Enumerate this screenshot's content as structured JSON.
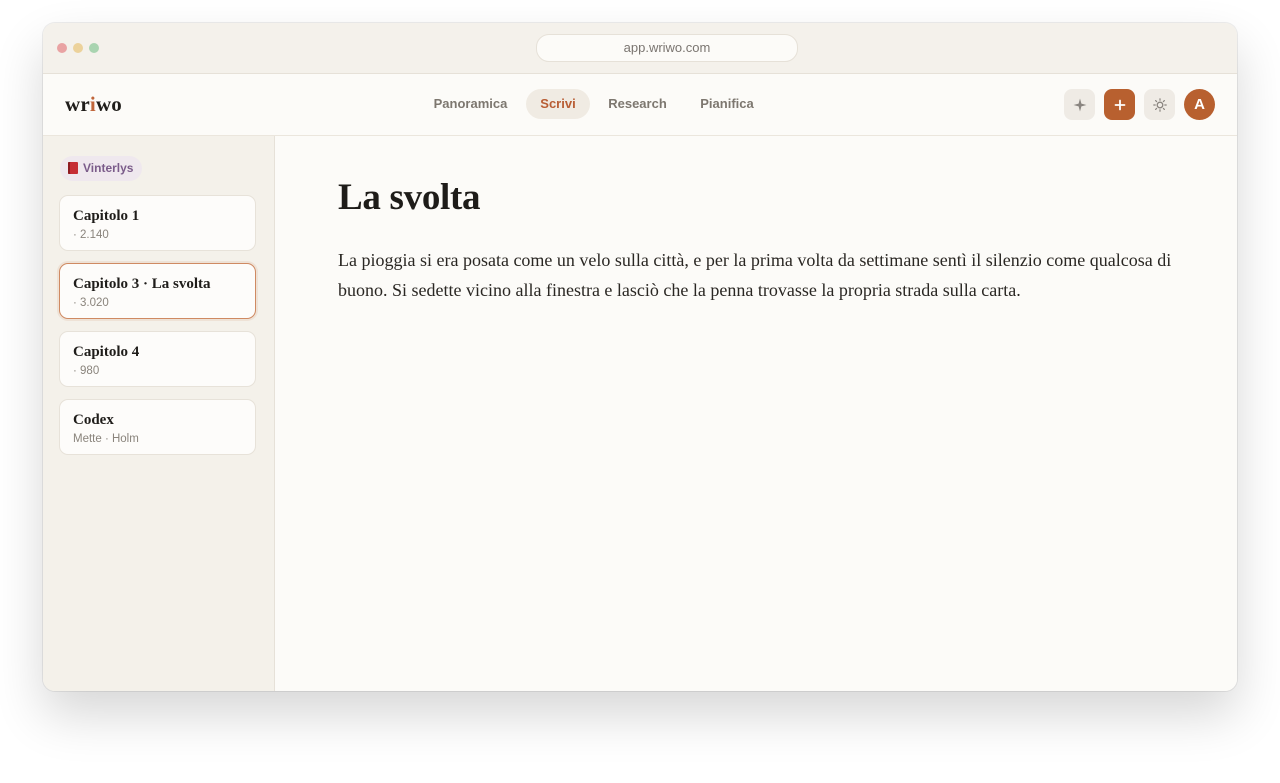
{
  "browser": {
    "url": "app.wriwo.com"
  },
  "app": {
    "logo_pre": "wr",
    "logo_accent": "i",
    "logo_post": "wo",
    "accent_color": "#b8602f"
  },
  "nav": {
    "items": [
      {
        "label": "Panoramica",
        "active": false
      },
      {
        "label": "Scrivi",
        "active": true
      },
      {
        "label": "Research",
        "active": false
      },
      {
        "label": "Pianifica",
        "active": false
      }
    ]
  },
  "toolbar": {
    "icons": [
      "sparkle-icon",
      "plus-icon",
      "sun-icon"
    ],
    "add_label": "+",
    "avatar_initial": "A"
  },
  "sidebar": {
    "project": {
      "icon": "book-icon",
      "name": "Vinterlys"
    },
    "chapters": [
      {
        "title": "Capitolo 1",
        "subtitle": "· 2.140",
        "active": false
      },
      {
        "title": "Capitolo 3 · La svolta",
        "subtitle": "· 3.020",
        "active": true
      },
      {
        "title": "Capitolo 4",
        "subtitle": "· 980",
        "active": false
      },
      {
        "title": "Codex",
        "subtitle": "Mette · Holm",
        "active": false
      }
    ]
  },
  "editor": {
    "title": "La svolta",
    "body": "La pioggia si era posata come un velo sulla città, e per la prima volta da settimane sentì il silenzio come qualcosa di buono. Si sedette vicino alla finestra e lasciò che la penna trovasse la propria strada sulla carta."
  }
}
